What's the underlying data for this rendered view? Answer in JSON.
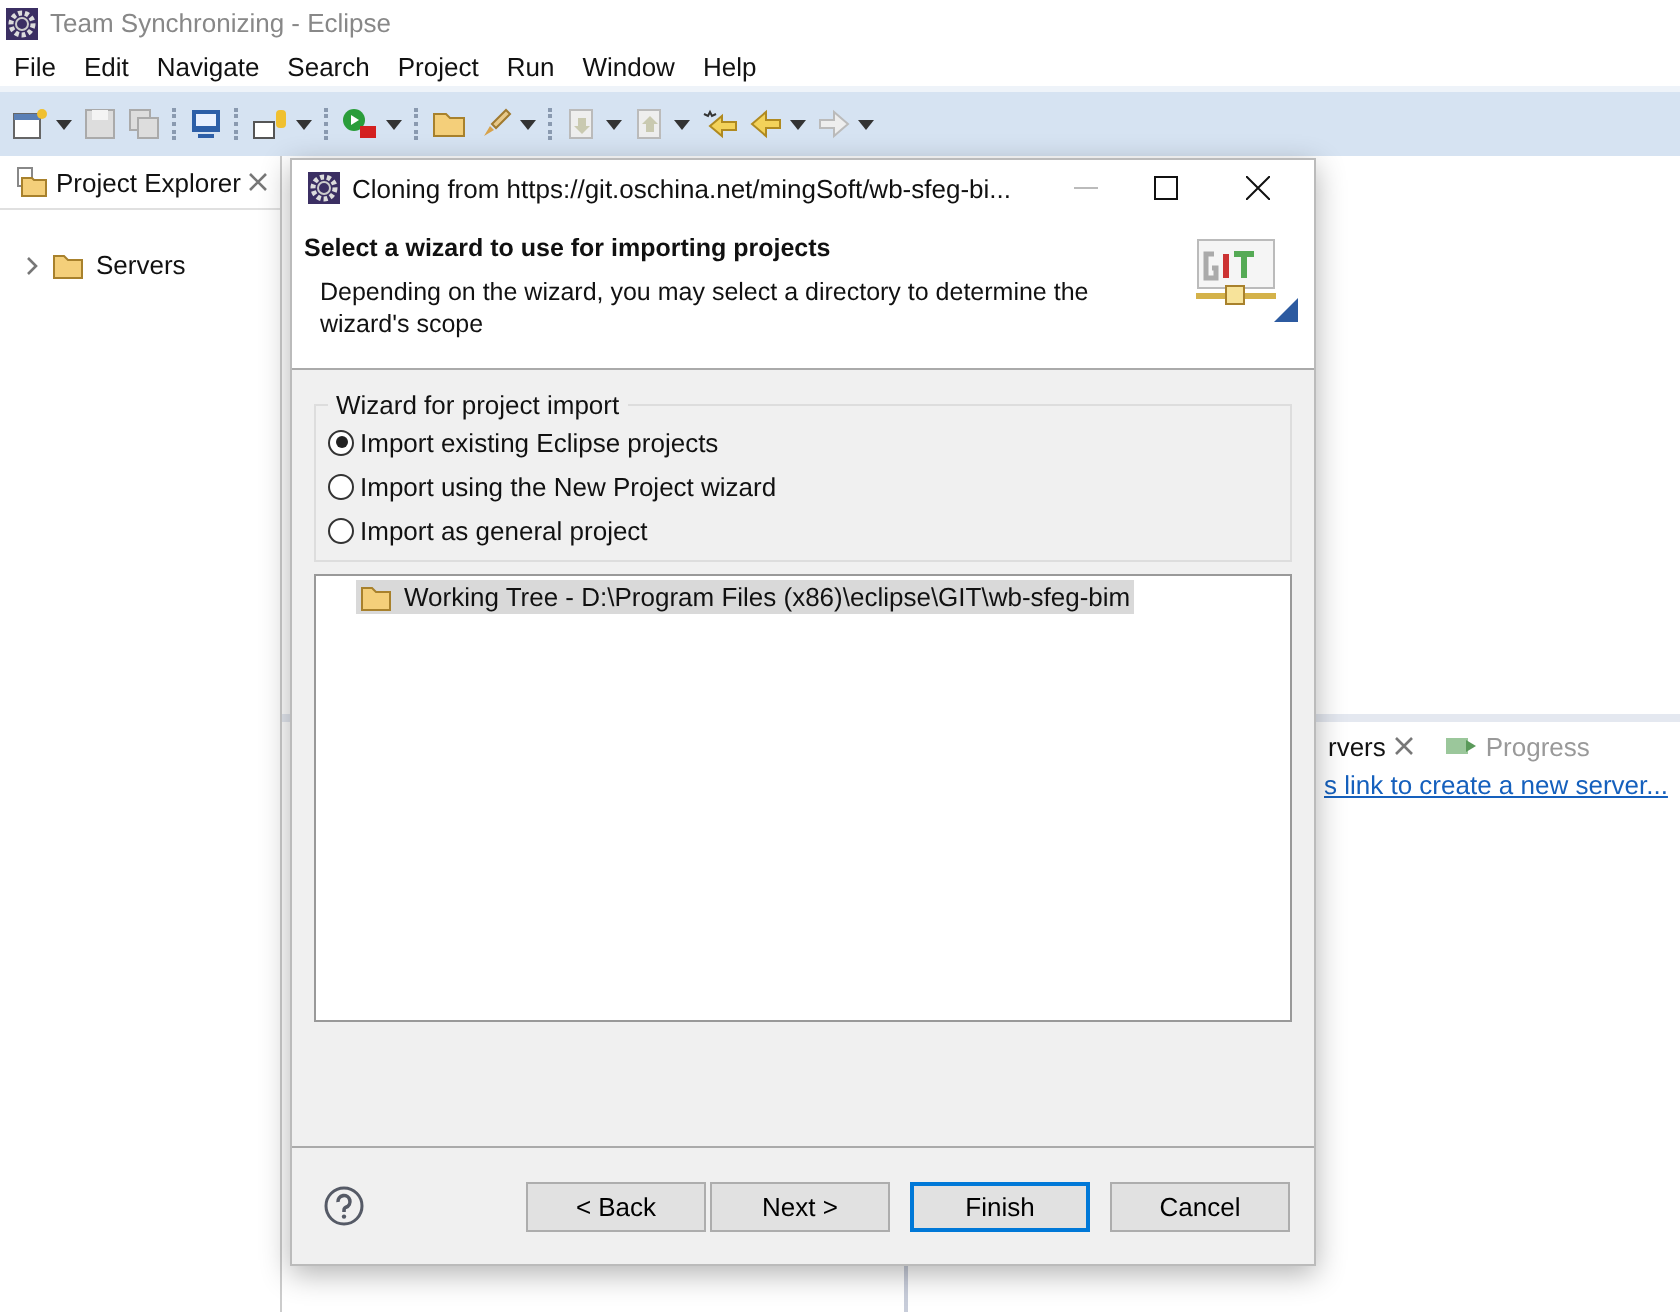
{
  "window": {
    "title": "Team Synchronizing - Eclipse"
  },
  "menu": [
    "File",
    "Edit",
    "Navigate",
    "Search",
    "Project",
    "Run",
    "Window",
    "Help"
  ],
  "project_explorer": {
    "title": "Project Explorer",
    "tree": [
      {
        "label": "Servers",
        "expanded": false
      }
    ]
  },
  "servers_view": {
    "tabs": [
      {
        "label": "rvers",
        "selected": true
      },
      {
        "label": "Progress",
        "selected": false
      }
    ],
    "link": "s link to create a new server..."
  },
  "dialog": {
    "title": "Cloning from https://git.oschina.net/mingSoft/wb-sfeg-bi...",
    "heading": "Select a wizard to use for importing projects",
    "description": "Depending on the wizard, you may select a directory to determine the wizard's scope",
    "group": {
      "title": "Wizard for project import",
      "options": [
        {
          "label": "Import existing Eclipse projects",
          "selected": true
        },
        {
          "label": "Import using the New Project wizard",
          "selected": false
        },
        {
          "label": "Import as general project",
          "selected": false
        }
      ]
    },
    "tree": [
      {
        "label": "Working Tree - D:\\Program Files (x86)\\eclipse\\GIT\\wb-sfeg-bim",
        "selected": true
      }
    ],
    "buttons": [
      {
        "label": "< Back",
        "default": false
      },
      {
        "label": "Next >",
        "default": false
      },
      {
        "label": "Finish",
        "default": true
      },
      {
        "label": "Cancel",
        "default": false
      }
    ]
  }
}
